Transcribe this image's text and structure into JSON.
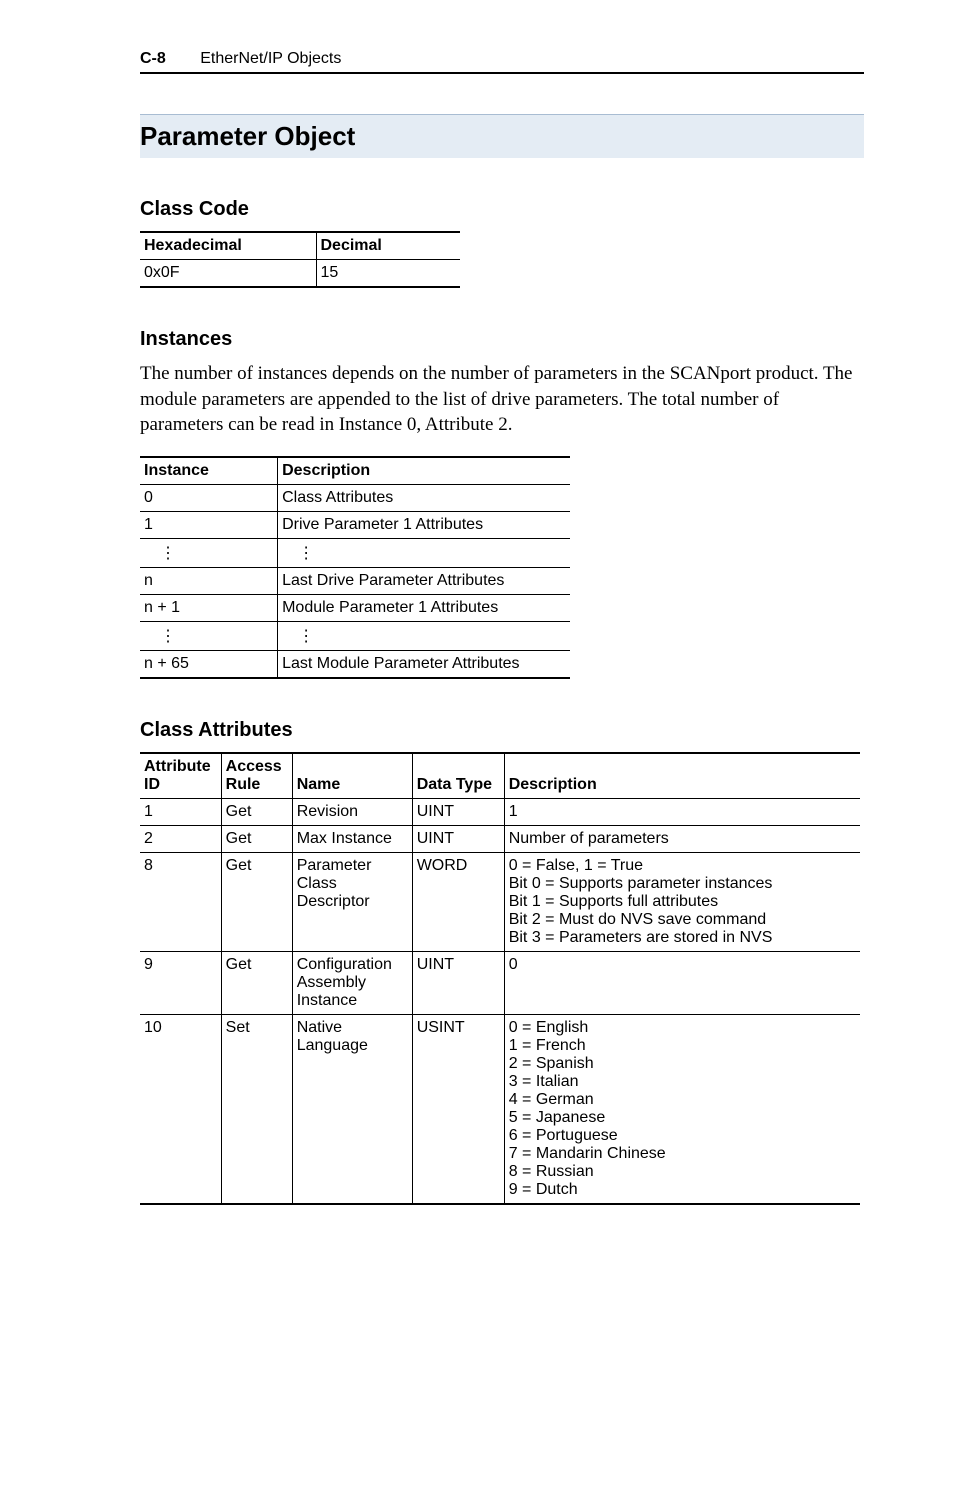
{
  "header": {
    "page_number": "C-8",
    "chapter": "EtherNet/IP Objects"
  },
  "section_title": "Parameter Object",
  "class_code": {
    "heading": "Class Code",
    "columns": [
      "Hexadecimal",
      "Decimal"
    ],
    "rows": [
      {
        "hex": "0x0F",
        "dec": "15"
      }
    ]
  },
  "instances": {
    "heading": "Instances",
    "paragraph": "The number of instances depends on the number of parameters in the SCANport product. The module parameters are appended to the list of drive parameters. The total number of parameters can be read in Instance 0, Attribute 2.",
    "columns": [
      "Instance",
      "Description"
    ],
    "rows": [
      {
        "inst": "0",
        "desc": "Class Attributes"
      },
      {
        "inst": "1",
        "desc": "Drive Parameter 1 Attributes"
      },
      {
        "inst": "⋮",
        "desc": "⋮"
      },
      {
        "inst": "n",
        "desc": "Last Drive Parameter Attributes"
      },
      {
        "inst": "n + 1",
        "desc": "Module Parameter 1 Attributes"
      },
      {
        "inst": "⋮",
        "desc": "⋮"
      },
      {
        "inst": "n + 65",
        "desc": "Last Module Parameter Attributes"
      }
    ]
  },
  "class_attributes": {
    "heading": "Class Attributes",
    "columns": [
      "Attribute ID",
      "Access Rule",
      "Name",
      "Data Type",
      "Description"
    ],
    "rows": [
      {
        "id": "1",
        "rule": "Get",
        "name": "Revision",
        "dtype": "UINT",
        "desc": "1"
      },
      {
        "id": "2",
        "rule": "Get",
        "name": "Max Instance",
        "dtype": "UINT",
        "desc": "Number of parameters"
      },
      {
        "id": "8",
        "rule": "Get",
        "name": "Parameter Class Descriptor",
        "dtype": "WORD",
        "desc": "0 = False, 1 = True\nBit 0 = Supports parameter instances\nBit 1 = Supports full attributes\nBit 2 = Must do NVS save command\nBit 3 = Parameters are stored in NVS"
      },
      {
        "id": "9",
        "rule": "Get",
        "name": "Configuration Assembly Instance",
        "dtype": "UINT",
        "desc": "0"
      },
      {
        "id": "10",
        "rule": "Set",
        "name": "Native Language",
        "dtype": "USINT",
        "desc": "0 = English\n1 = French\n2 = Spanish\n3 = Italian\n4 = German\n5 = Japanese\n6 = Portuguese\n7 = Mandarin Chinese\n8 = Russian\n9 = Dutch"
      }
    ]
  }
}
